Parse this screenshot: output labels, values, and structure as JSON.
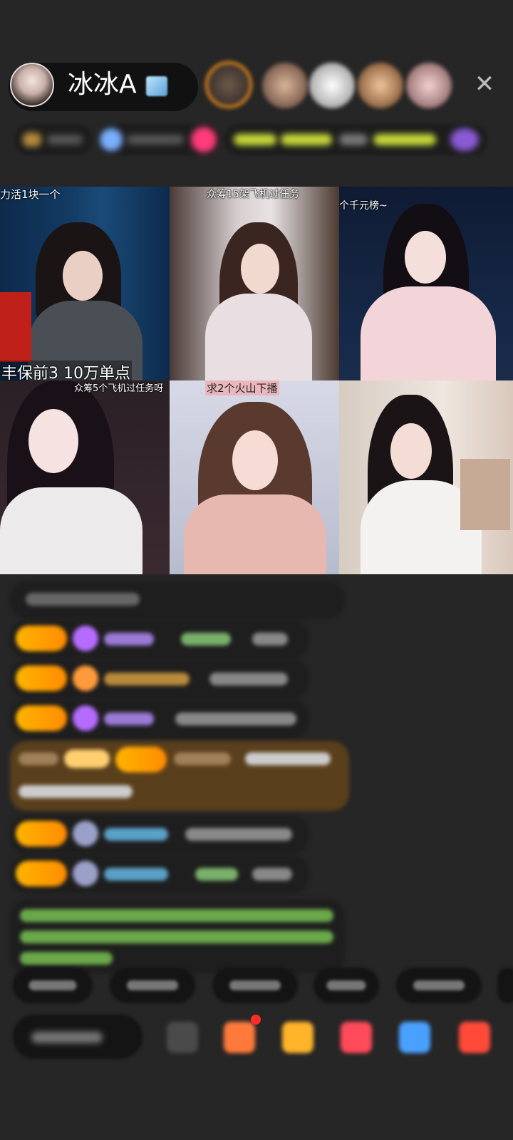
{
  "header": {
    "host_name": "冰冰A",
    "close_icon": "close-icon"
  },
  "tiles": [
    {
      "caption": "力活1块一个",
      "bottom_caption": "丰保前3 10万单点"
    },
    {
      "caption": "众筹15架飞机过任务",
      "bottom_caption": ""
    },
    {
      "caption": "个千元榜~",
      "bottom_caption": ""
    },
    {
      "caption": "众筹5个飞机过任务呀",
      "bottom_caption": ""
    },
    {
      "caption": "求2个火山下播",
      "bottom_caption": ""
    },
    {
      "caption": "",
      "bottom_caption": ""
    }
  ],
  "colors": {
    "background": "#262626",
    "level_badge": "#ffb400",
    "highlight_message": "#5a3f1c",
    "green_text": "#8fd14f"
  }
}
